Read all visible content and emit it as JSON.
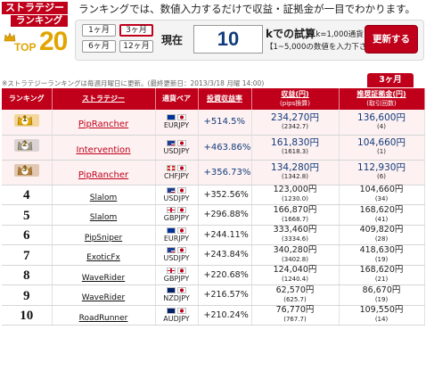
{
  "logo": {
    "line1": "ストラテジー",
    "line2": "ランキング",
    "top_word": "TOP",
    "top_num": "20"
  },
  "headline": "ランキングでは、数値入力するだけで収益・証拠金が一目でわかります。",
  "period_buttons": [
    "1ヶ月",
    "3ヶ月",
    "6ヶ月",
    "12ヶ月"
  ],
  "selected_period": "3ヶ月",
  "current_label": "現在",
  "amount_value": "10",
  "k_label": "kでの試算",
  "k_note": "1k=1,000通貨",
  "range_note": "【1~5,000の数値を入力下さい】",
  "update_button": "更新する",
  "note": "※ストラテジーランキングは毎週月曜日に更新。(最終更新日：2013/3/18 月曜 14:00)",
  "period_tab": "3ヶ月",
  "columns": {
    "rank": "ランキング",
    "strategy": "ストラテジー",
    "pair": "通貨ペア",
    "yield": "投資収益率",
    "profit": "収益(円)",
    "profit_sub": "(pips換算)",
    "margin": "推奨証拠金(円)",
    "margin_sub": "(取引回数)"
  },
  "rows": [
    {
      "rank": "1",
      "strategy": "PipRancher",
      "pair": "EURJPY",
      "yield": "+514.5%",
      "profit": "234,270円",
      "pips": "(2342.7)",
      "margin": "136,600円",
      "trades": "(4)"
    },
    {
      "rank": "2",
      "strategy": "Intervention",
      "pair": "USDJPY",
      "yield": "+463.86%",
      "profit": "161,830円",
      "pips": "(1618.3)",
      "margin": "104,660円",
      "trades": "(1)"
    },
    {
      "rank": "3",
      "strategy": "PipRancher",
      "pair": "CHFJPY",
      "yield": "+356.73%",
      "profit": "134,280円",
      "pips": "(1342.8)",
      "margin": "112,930円",
      "trades": "(6)"
    },
    {
      "rank": "4",
      "strategy": "Slalom",
      "pair": "USDJPY",
      "yield": "+352.56%",
      "profit": "123,000円",
      "pips": "(1230.0)",
      "margin": "104,660円",
      "trades": "(34)"
    },
    {
      "rank": "5",
      "strategy": "Slalom",
      "pair": "GBPJPY",
      "yield": "+296.88%",
      "profit": "166,870円",
      "pips": "(1668.7)",
      "margin": "168,620円",
      "trades": "(41)"
    },
    {
      "rank": "6",
      "strategy": "PipSniper",
      "pair": "EURJPY",
      "yield": "+244.11%",
      "profit": "333,460円",
      "pips": "(3334.6)",
      "margin": "409,820円",
      "trades": "(28)"
    },
    {
      "rank": "7",
      "strategy": "ExoticFx",
      "pair": "USDJPY",
      "yield": "+243.84%",
      "profit": "340,280円",
      "pips": "(3402.8)",
      "margin": "418,630円",
      "trades": "(19)"
    },
    {
      "rank": "8",
      "strategy": "WaveRider",
      "pair": "GBPJPY",
      "yield": "+220.68%",
      "profit": "124,040円",
      "pips": "(1240.4)",
      "margin": "168,620円",
      "trades": "(21)"
    },
    {
      "rank": "9",
      "strategy": "WaveRider",
      "pair": "NZDJPY",
      "yield": "+216.57%",
      "profit": "62,570円",
      "pips": "(625.7)",
      "margin": "86,670円",
      "trades": "(19)"
    },
    {
      "rank": "10",
      "strategy": "RoadRunner",
      "pair": "AUDJPY",
      "yield": "+210.24%",
      "profit": "76,770円",
      "pips": "(767.7)",
      "margin": "109,550円",
      "trades": "(14)"
    }
  ],
  "colors": {
    "brand_red": "#c0001a",
    "value_blue": "#123c7c",
    "gold": "#e2a400",
    "silver": "#9a9a9a",
    "bronze": "#b07a3c"
  }
}
